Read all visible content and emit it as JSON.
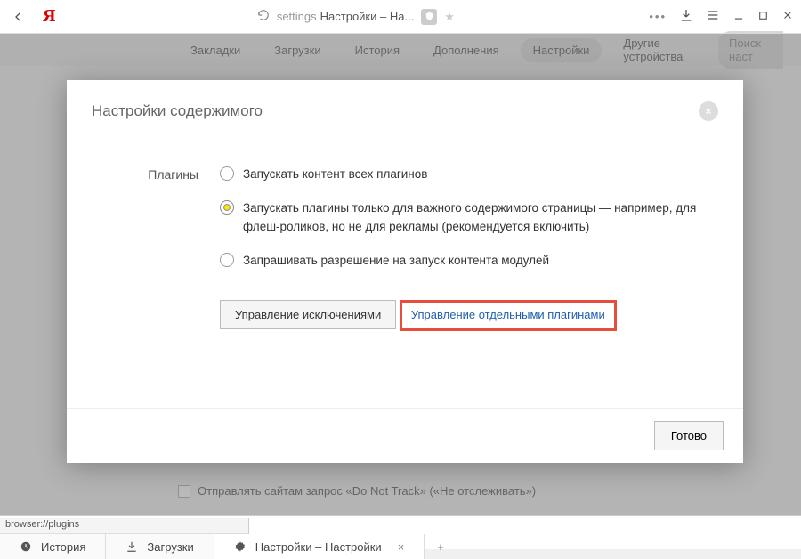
{
  "chrome": {
    "logo": "Я",
    "address_prefix": "settings",
    "address_title": "Настройки – На..."
  },
  "bg_tabs": {
    "items": [
      "Закладки",
      "Загрузки",
      "История",
      "Дополнения",
      "Настройки",
      "Другие устройства"
    ],
    "search_placeholder": "Поиск наст"
  },
  "bg_page": {
    "track_label": "Отправлять сайтам запрос «Do Not Track» («Не отслеживать»)"
  },
  "modal": {
    "title": "Настройки содержимого",
    "section_label": "Плагины",
    "radios": [
      "Запускать контент всех плагинов",
      "Запускать плагины только для важного содержимого страницы — например, для флеш-роликов, но не для рекламы (рекомендуется включить)",
      "Запрашивать разрешение на запуск контента модулей"
    ],
    "manage_exceptions": "Управление исключениями",
    "plugin_link": "Управление отдельными плагинами",
    "done": "Готово"
  },
  "status_bar": "browser://plugins",
  "bottom_tabs": {
    "history": "История",
    "downloads": "Загрузки",
    "settings": "Настройки – Настройки"
  }
}
